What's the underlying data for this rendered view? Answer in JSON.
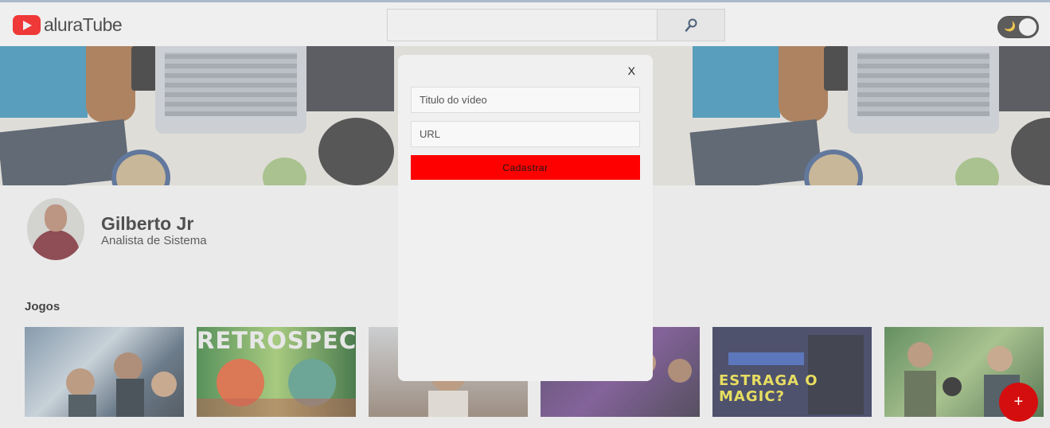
{
  "header": {
    "logo_text": "aluraTube",
    "search_placeholder": "",
    "search_icon": "magnifier-icon",
    "theme_icon": "moon-icon"
  },
  "profile": {
    "name": "Gilberto Jr",
    "role": "Analista de Sistema"
  },
  "timeline": {
    "title": "Jogos",
    "videos": [
      {
        "text": ""
      },
      {
        "text": "RETROSPECTIVA"
      },
      {
        "text": ""
      },
      {
        "text": ""
      },
      {
        "text": "ESTRAGA O MAGIC?"
      },
      {
        "text": ""
      }
    ]
  },
  "modal": {
    "close_label": "X",
    "title_placeholder": "Titulo do vídeo",
    "url_placeholder": "URL",
    "submit_label": "Cadastrar"
  },
  "fab": {
    "label": "+"
  },
  "colors": {
    "brand": "#ff0000",
    "modal_bg": "#f0f0f0",
    "fab": "#d40e0e"
  }
}
